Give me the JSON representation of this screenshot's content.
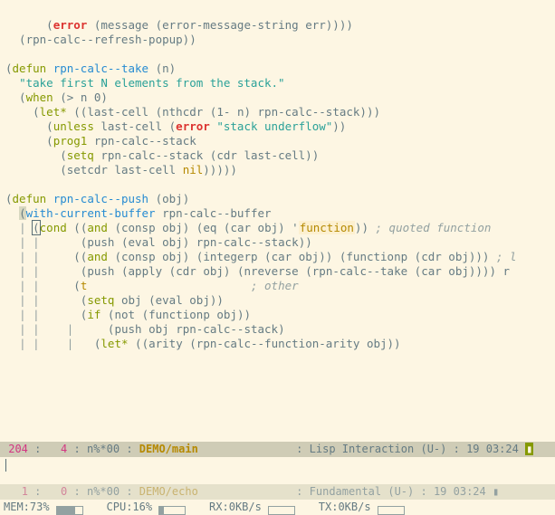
{
  "code": {
    "l1_a": "error",
    "l1_b": "message",
    "l1_c": "error-message-string",
    "l1_d": "err",
    "l2_a": "rpn-calc--refresh-popup",
    "l4_defun": "defun",
    "l4_name": "rpn-calc--take",
    "l4_arg": "n",
    "l5_doc": "\"take first N elements from the stack.\"",
    "l6_when": "when",
    "l6_gt": ">",
    "l6_n": "n",
    "l6_0": "0",
    "l7_let": "let*",
    "l7_var": "last-cell",
    "l7_nth": "nthcdr",
    "l7_1m": "1-",
    "l7_n": "n",
    "l7_stack": "rpn-calc--stack",
    "l8_unless": "unless",
    "l8_var": "last-cell",
    "l8_error": "error",
    "l8_msg": "\"stack underflow\"",
    "l9_prog1": "prog1",
    "l9_stack": "rpn-calc--stack",
    "l10_setq": "setq",
    "l10_stack": "rpn-calc--stack",
    "l10_cdr": "cdr",
    "l10_var": "last-cell",
    "l11_setcdr": "setcdr",
    "l11_var": "last-cell",
    "l11_nil": "nil",
    "l13_defun": "defun",
    "l13_name": "rpn-calc--push",
    "l13_arg": "obj",
    "l14_wcb": "with-current-buffer",
    "l14_buf": "rpn-calc--buffer",
    "l15_cond": "cond",
    "l15_and": "and",
    "l15_consp": "consp",
    "l15_obj": "obj",
    "l15_eq": "eq",
    "l15_car": "car",
    "l15_func": "function",
    "l15_cmt": "; quoted function",
    "l16_push": "push",
    "l16_eval": "eval",
    "l16_obj": "obj",
    "l16_stack": "rpn-calc--stack",
    "l17_and": "and",
    "l17_consp": "consp",
    "l17_obj": "obj",
    "l17_intp": "integerp",
    "l17_car": "car",
    "l17_funcp": "functionp",
    "l17_cdr": "cdr",
    "l17_cmt": "; l",
    "l18_push": "push",
    "l18_apply": "apply",
    "l18_cdr": "cdr",
    "l18_obj": "obj",
    "l18_nrev": "nreverse",
    "l18_take": "rpn-calc--take",
    "l18_car": "car",
    "l18_tail": "r",
    "l19_t": "t",
    "l19_cmt": "; other",
    "l20_setq": "setq",
    "l20_obj": "obj",
    "l20_eval": "eval",
    "l21_if": "if",
    "l21_not": "not",
    "l21_funcp": "functionp",
    "l21_obj": "obj",
    "l22_push": "push",
    "l22_obj": "obj",
    "l22_stack": "rpn-calc--stack",
    "l23_let": "let*",
    "l23_arity": "arity",
    "l23_fn": "rpn-calc--function-arity",
    "l23_obj": "obj"
  },
  "modeline_main": {
    "line": "204",
    "col": "4",
    "flags": "n%*00",
    "branch": "DEMO/main",
    "mode": "Lisp Interaction",
    "enc": "(U-)",
    "time": "19 03:24"
  },
  "modeline_echo": {
    "line": "1",
    "col": "0",
    "flags": "n%*00",
    "branch": "DEMO/echo",
    "mode": "Fundamental",
    "enc": "(U-)",
    "time": "19 03:24"
  },
  "status": {
    "mem_label": "MEM:",
    "mem": "73%",
    "cpu_label": "CPU:",
    "cpu": "16%",
    "rx_label": "RX:",
    "rx": "0KB/s",
    "tx_label": "TX:",
    "tx": "0KB/s"
  }
}
